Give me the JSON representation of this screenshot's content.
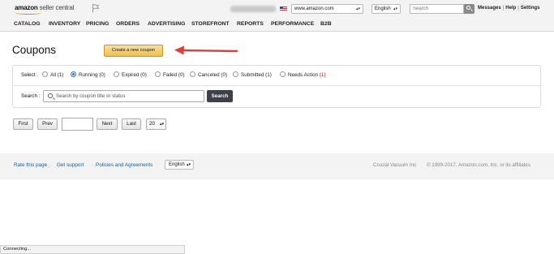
{
  "header": {
    "logo_bold": "amazon",
    "logo_light": " seller central",
    "marketplace": "www.amazon.com",
    "language": "English",
    "search_placeholder": "Search",
    "links": [
      "Messages",
      "Help",
      "Settings"
    ],
    "link_separator": "|"
  },
  "nav": {
    "items": [
      "CATALOG",
      "INVENTORY",
      "PRICING",
      "ORDERS",
      "ADVERTISING",
      "STOREFRONT",
      "REPORTS",
      "PERFORMANCE",
      "B2B"
    ]
  },
  "page": {
    "title": "Coupons",
    "create_button": "Create a new coupon"
  },
  "filter": {
    "select_label": "Select :",
    "options": [
      {
        "label": "All (1)",
        "selected": false
      },
      {
        "label": "Running (0)",
        "selected": true
      },
      {
        "label": "Expired (0)",
        "selected": false
      },
      {
        "label": "Failed (0)",
        "selected": false
      },
      {
        "label": "Canceled (0)",
        "selected": false
      },
      {
        "label": "Submitted (1)",
        "selected": false
      },
      {
        "label": "Needs Action",
        "count": "(1)",
        "selected": false
      }
    ],
    "search_label": "Search :",
    "search_placeholder": "Search by coupon title or status",
    "search_button": "Search"
  },
  "pagination": {
    "first": "First",
    "prev": "Prev",
    "page_value": "",
    "next": "Next",
    "last": "Last",
    "page_size": "20"
  },
  "footer": {
    "links": [
      "Rate this page",
      "Get support",
      "Policies and Agreements"
    ],
    "language": "English",
    "company": "Crucial Vacuum Inc",
    "copyright": "© 1999-2017, Amazon.com, Inc. or its affiliates"
  },
  "status_bar": {
    "text": "Connecting..."
  },
  "colors": {
    "accent_button": "#f0c14b",
    "annotation_arrow": "#d9403a",
    "link": "#1a5c9e",
    "selected_radio": "#2f6fd6",
    "alert_count": "#c40000"
  }
}
